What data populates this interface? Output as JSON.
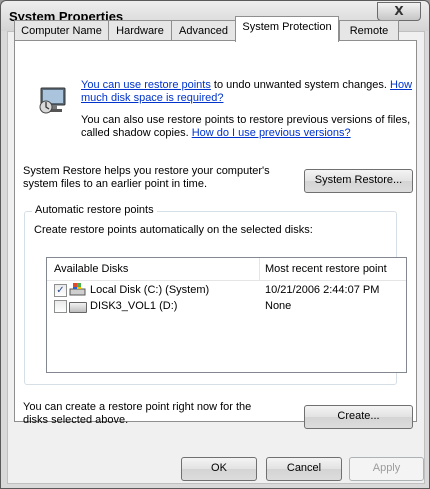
{
  "window": {
    "title": "System Properties",
    "close_glyph": "X"
  },
  "tabs": [
    {
      "label": "Computer Name"
    },
    {
      "label": "Hardware"
    },
    {
      "label": "Advanced"
    },
    {
      "label": "System Protection",
      "active": true
    },
    {
      "label": "Remote"
    }
  ],
  "intro": {
    "line1_link": "You can use restore points",
    "line1_rest": " to undo unwanted system changes. ",
    "line1_link2": "How",
    "line2_link": "much disk space is required?",
    "line3": "You can also use restore points to restore previous versions of files,",
    "line4_text": "called shadow copies. ",
    "line4_link": "How do I use previous versions?"
  },
  "system_restore": {
    "desc_line1": "System Restore helps you restore your computer's",
    "desc_line2": "system files to an earlier point in time.",
    "button": "System Restore..."
  },
  "auto_restore": {
    "group_label": "Automatic restore points",
    "instruction": "Create restore points automatically on the selected disks:",
    "columns": [
      "Available Disks",
      "Most recent restore point"
    ],
    "disks": [
      {
        "name": "Local Disk (C:) (System)",
        "last_point": "10/21/2006 2:44:07 PM",
        "checked": true,
        "icon": "system-drive-icon"
      },
      {
        "name": "DISK3_VOL1 (D:)",
        "last_point": "None",
        "checked": false,
        "icon": "drive-icon"
      }
    ]
  },
  "create": {
    "desc_line1": "You can create a restore point right now for the",
    "desc_line2": "disks selected above.",
    "button": "Create..."
  },
  "footer": {
    "ok": "OK",
    "cancel": "Cancel",
    "apply": "Apply"
  },
  "colors": {
    "link": "#0033cc",
    "dialog_bg": "#f0f0f0"
  }
}
